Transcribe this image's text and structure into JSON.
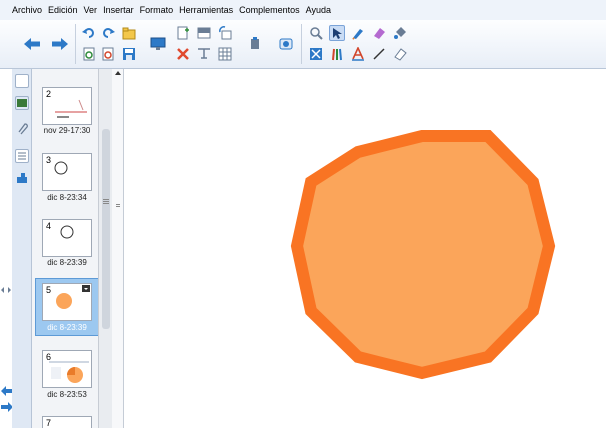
{
  "menu": [
    "Archivo",
    "Edición",
    "Ver",
    "Insertar",
    "Formato",
    "Herramientas",
    "Complementos",
    "Ayuda"
  ],
  "toolbar": {
    "icons": [
      "back-arrow-icon",
      "forward-arrow-icon",
      "undo-icon",
      "redo-icon",
      "open-icon",
      "save-icon",
      "new-page-icon",
      "delete-icon",
      "screen-shade-icon",
      "table-icon",
      "document-camera-icon",
      "screen-capture-icon",
      "select-icon",
      "pens-icon",
      "creative-pens-icon",
      "eraser-icon",
      "line-icon",
      "shapes-icon",
      "fill-icon",
      "text-icon",
      "properties-icon"
    ]
  },
  "colors": {
    "accent": "#7aa3d8",
    "selection": "#9cc8f0",
    "shape_fill": "#fba55a",
    "shape_stroke": "#f97423"
  },
  "slides": [
    {
      "number": "2",
      "label": "nov 29-17:30"
    },
    {
      "number": "3",
      "label": "dic 8-23:34"
    },
    {
      "number": "4",
      "label": "dic 8-23:39"
    },
    {
      "number": "5",
      "label": "dic 8-23:39"
    },
    {
      "number": "6",
      "label": "dic 8-23:53"
    },
    {
      "number": "7",
      "label": ""
    }
  ]
}
